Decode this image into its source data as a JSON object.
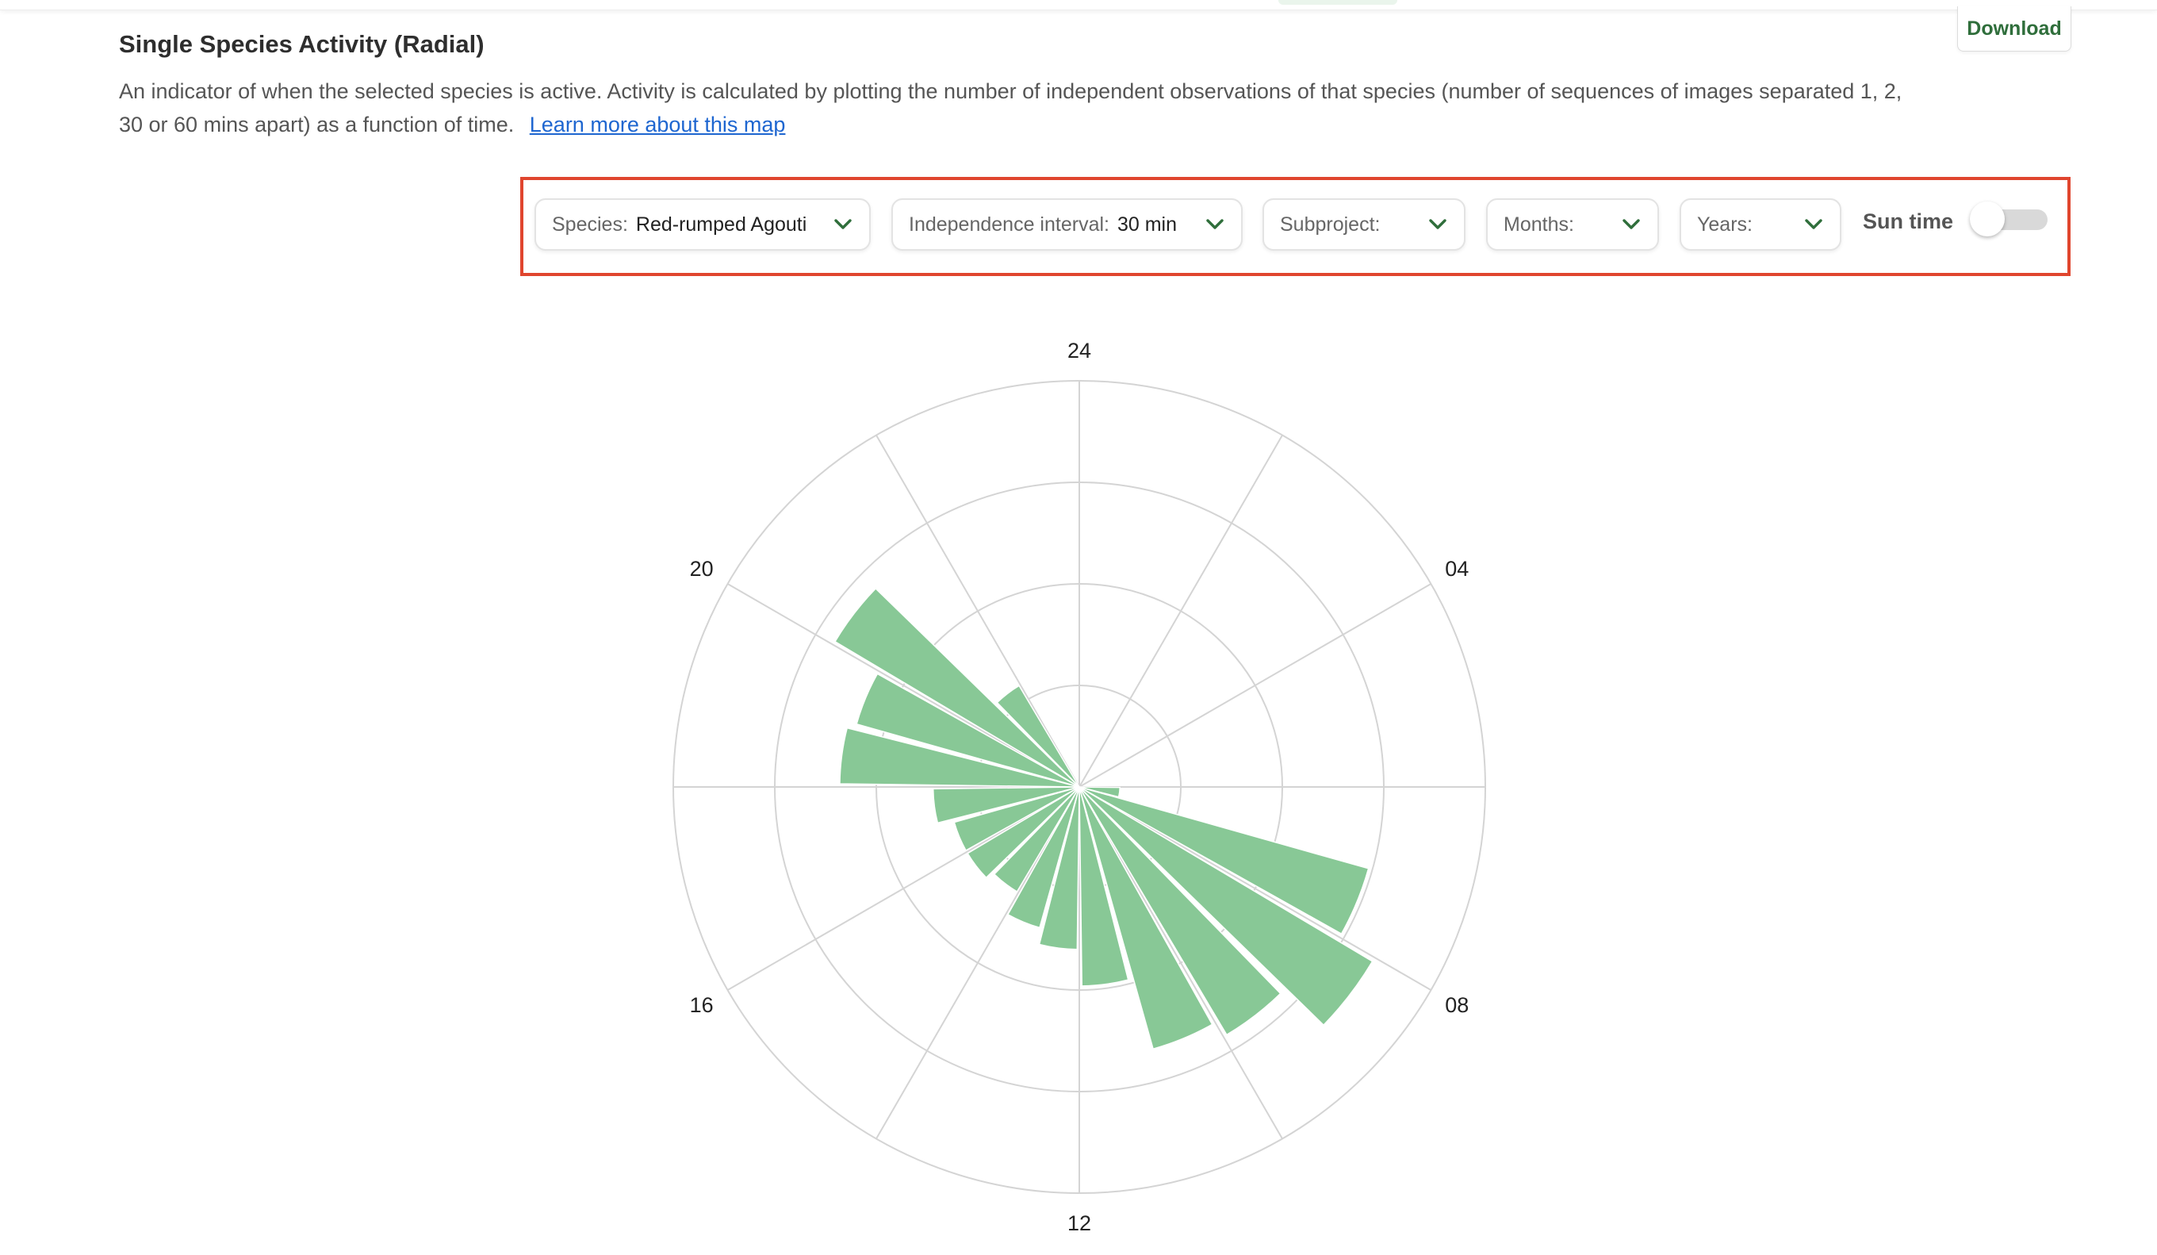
{
  "section": {
    "title": "Single Species Activity (Radial)",
    "description": "An indicator of when the selected species is active. Activity is calculated by plotting the number of independent observations of that species (number of sequences of images separated 1, 2, 30 or 60 mins apart) as a function of time.",
    "learn_more_link": "Learn more about this map",
    "download_label": "Download"
  },
  "filters": {
    "species": {
      "label": "Species:",
      "value": "Red-rumped Agouti"
    },
    "interval": {
      "label": "Independence interval:",
      "value": "30 min"
    },
    "subproject": {
      "label": "Subproject:",
      "value": ""
    },
    "months": {
      "label": "Months:",
      "value": ""
    },
    "years": {
      "label": "Years:",
      "value": ""
    },
    "sun_time": {
      "label": "Sun time",
      "enabled": false
    }
  },
  "colors": {
    "bar_fill": "#88c896",
    "grid": "#d4d4d4",
    "accent_green": "#2f6e3b",
    "highlight_frame": "#e0452e",
    "link": "#1e66d0"
  },
  "chart_data": {
    "type": "radial-bar",
    "angular_axis": "hour of day",
    "direction": "clockwise, 24/00 at top",
    "tick_labels": [
      "24",
      "04",
      "08",
      "12",
      "16",
      "20"
    ],
    "hours": [
      0,
      1,
      2,
      3,
      4,
      5,
      6,
      7,
      8,
      9,
      10,
      11,
      12,
      13,
      14,
      15,
      16,
      17,
      18,
      19,
      20,
      21,
      22,
      23
    ],
    "values": [
      0,
      0,
      0,
      0,
      0,
      0,
      0.1,
      0.74,
      0.84,
      0.71,
      0.67,
      0.49,
      0.4,
      0.36,
      0.3,
      0.32,
      0.32,
      0.36,
      0.59,
      0.57,
      0.7,
      0.29,
      0,
      0
    ],
    "rmax": 1.0,
    "radial_gridlines": [
      0.25,
      0.5,
      0.75,
      1.0
    ],
    "radial_tick_labels_shown": false,
    "grid": true,
    "legend": "none"
  }
}
